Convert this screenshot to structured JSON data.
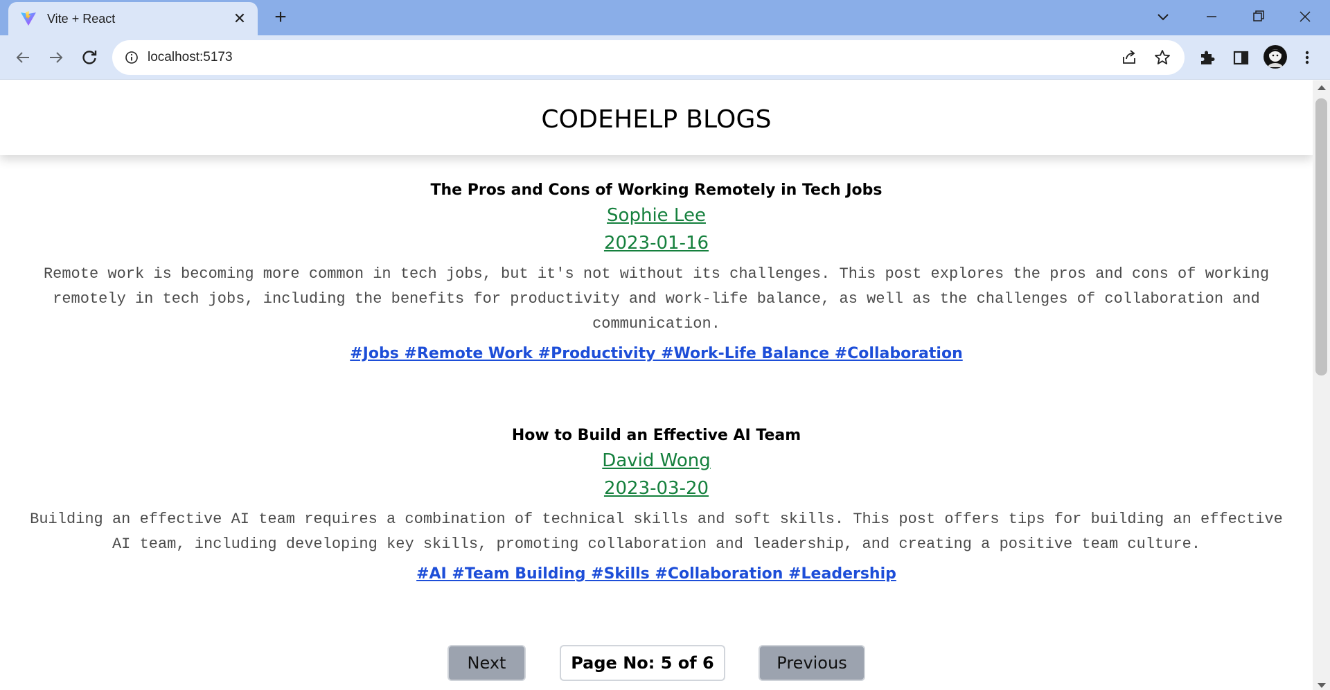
{
  "browser": {
    "tab_title": "Vite + React",
    "url": "localhost:5173",
    "icons": {
      "favicon": "vite-logo-icon",
      "close_tab": "close-icon",
      "new_tab": "plus-icon",
      "tab_search": "chevron-down-icon",
      "back": "arrow-left-icon",
      "forward": "arrow-right-icon",
      "reload": "reload-icon",
      "site_info": "info-icon",
      "share": "share-icon",
      "bookmark": "star-icon",
      "extensions": "puzzle-icon",
      "side_panel": "side-panel-icon",
      "profile": "avatar",
      "menu": "kebab-menu-icon",
      "minimize": "minimize-icon",
      "restore": "restore-icon",
      "close_window": "close-icon"
    },
    "colors": {
      "tabbar": "#8aaee8",
      "toolbar": "#dbe6f8"
    }
  },
  "header": {
    "title": "CODEHELP BLOGS"
  },
  "posts": [
    {
      "title": "The Pros and Cons of Working Remotely in Tech Jobs",
      "author": "Sophie Lee",
      "date": "2023-01-16",
      "content_lines": [
        "Remote work is becoming more common in tech jobs, but it's not without its challenges. This post explores the pros and cons of working",
        "remotely in tech jobs, including the benefits for productivity and work-life balance, as well as the challenges of collaboration and",
        "communication."
      ],
      "tags": "#Jobs #Remote Work #Productivity #Work-Life Balance #Collaboration"
    },
    {
      "title": "How to Build an Effective AI Team",
      "author": "David Wong",
      "date": "2023-03-20",
      "content_lines": [
        "Building an effective AI team requires a combination of technical skills and soft skills. This post offers tips for building an effective",
        "AI team, including developing key skills, promoting collaboration and leadership, and creating a positive team culture."
      ],
      "tags": "#AI #Team Building #Skills #Collaboration #Leadership"
    }
  ],
  "pagination": {
    "next_label": "Next",
    "page_label": "Page No: 5 of 6",
    "previous_label": "Previous"
  },
  "colors": {
    "author_date": "#15803d",
    "tags": "#1d4ed8",
    "button_bg": "#9ca3af"
  }
}
